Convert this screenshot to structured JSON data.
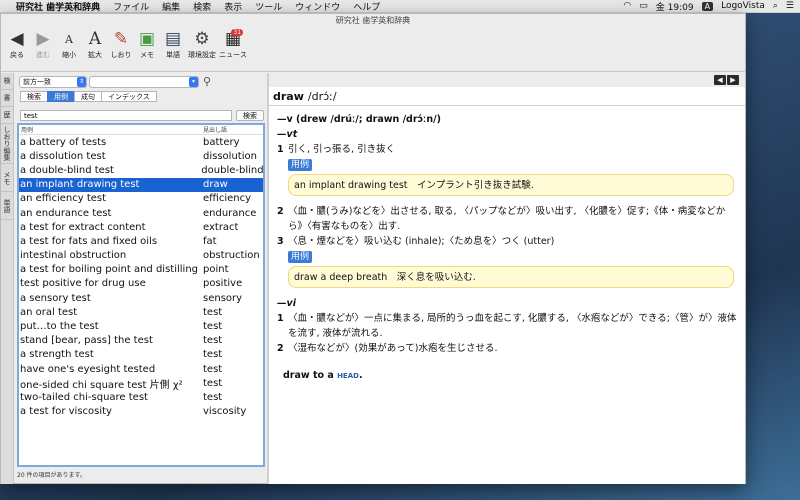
{
  "menubar": {
    "app_name": "研究社 歯学英和辞典",
    "items": [
      "ファイル",
      "編集",
      "検索",
      "表示",
      "ツール",
      "ウィンドウ",
      "ヘルプ"
    ],
    "clock": "金 19:09",
    "input_badge": "A",
    "right_app": "LogoVista"
  },
  "window": {
    "title": "研究社 歯学英和辞典"
  },
  "toolbar": {
    "back_label": "戻る",
    "forward_label": "進む",
    "shrink_label": "縮小",
    "enlarge_label": "拡大",
    "bookmark_label": "しおり",
    "memo_label": "メモ",
    "wordbook_label": "単語",
    "settings_label": "環境設定",
    "news_label": "ニュース",
    "news_badge": "31"
  },
  "vstrip": {
    "tab1": "検",
    "tab2": "書",
    "tab3": "歴",
    "tab4": "しおり編集",
    "tab5": "メモ",
    "tab6": "単語"
  },
  "search": {
    "match_mode": "前方一致",
    "dict_select": "",
    "tabs": [
      "検索",
      "用例",
      "成句",
      "インデックス"
    ],
    "active_tab_index": 1,
    "query_value": "test",
    "search_button": "検索",
    "col_example": "用例",
    "col_headword": "見出し語",
    "results": [
      {
        "example": "a battery of tests",
        "headword": "battery"
      },
      {
        "example": "a dissolution test",
        "headword": "dissolution"
      },
      {
        "example": "a double-blind test",
        "headword": "double-blind"
      },
      {
        "example": "an implant drawing test",
        "headword": "draw"
      },
      {
        "example": "an efficiency test",
        "headword": "efficiency"
      },
      {
        "example": "an endurance test",
        "headword": "endurance"
      },
      {
        "example": "a test for extract content",
        "headword": "extract"
      },
      {
        "example": "a test for fats and fixed oils",
        "headword": "fat"
      },
      {
        "example": "intestinal obstruction",
        "headword": "obstruction"
      },
      {
        "example": "a test for boiling point and distilling",
        "headword": "point"
      },
      {
        "example": "test positive for drug use",
        "headword": "positive"
      },
      {
        "example": "a sensory test",
        "headword": "sensory"
      },
      {
        "example": "an oral test",
        "headword": "test"
      },
      {
        "example": "put…to the test",
        "headword": "test"
      },
      {
        "example": "stand [bear, pass] the test",
        "headword": "test"
      },
      {
        "example": "a strength test",
        "headword": "test"
      },
      {
        "example": "have one's eyesight tested",
        "headword": "test"
      },
      {
        "example": "one-sided chi square test 片側 χ²",
        "headword": "test"
      },
      {
        "example": "two-tailed chi-square test",
        "headword": "test"
      },
      {
        "example": "a test for viscosity",
        "headword": "viscosity"
      }
    ],
    "selected_index": 3,
    "status": "20 件の項目があります。"
  },
  "detail": {
    "headword": "draw",
    "pron": "/drɔ́ː/",
    "forms": "—v (drew /drúː/; drawn /drɔ́ːn/)",
    "vt_label": "—vt",
    "sense1_num": "1",
    "sense1_text": "引く, 引っ張る, 引き抜く",
    "yourei_label": "用例",
    "example1": "an implant drawing test　インプラント引き抜き試験.",
    "sense2_num": "2",
    "sense2_text": "〈血・膿(うみ)などを〉出させる, 取る, 〈パップなどが〉吸い出す, 〈化膿を〉促す;《体・病変などから》〈有害なものを〉出す.",
    "sense3_num": "3",
    "sense3_text": "〈息・煙などを〉吸い込む (inhale);〈ため息を〉つく (utter)",
    "example2": "draw a deep breath　深く息を吸い込む.",
    "vi_label": "—vi",
    "vi1_num": "1",
    "vi1_text": "〈血・膿などが〉一点に集まる, 局所的うっ血を起こす, 化膿する, 〈水疱などが〉できる;〈管〉が〉液体を流す, 液体が流れる.",
    "vi2_num": "2",
    "vi2_text": "〈湿布などが〉(効果があって)水疱を生じさせる.",
    "phrase_text": "draw to a",
    "phrase_cap": "HEAD"
  }
}
